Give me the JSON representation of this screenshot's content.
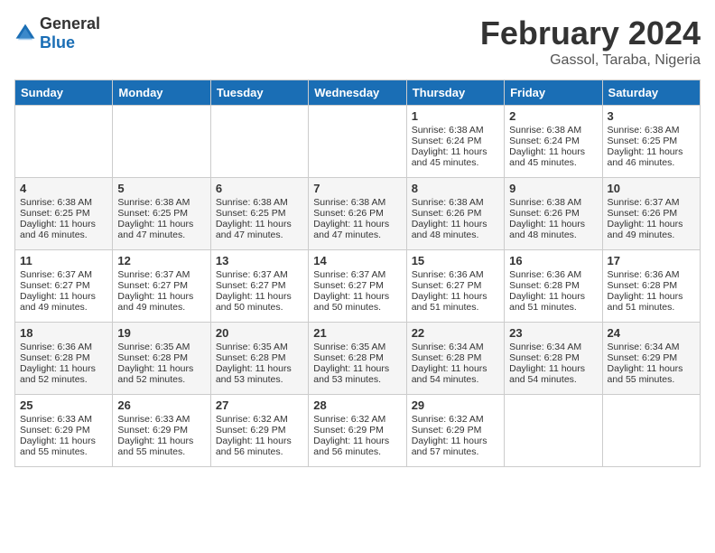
{
  "header": {
    "logo_general": "General",
    "logo_blue": "Blue",
    "month_year": "February 2024",
    "location": "Gassol, Taraba, Nigeria"
  },
  "days_of_week": [
    "Sunday",
    "Monday",
    "Tuesday",
    "Wednesday",
    "Thursday",
    "Friday",
    "Saturday"
  ],
  "weeks": [
    [
      {
        "day": "",
        "info": ""
      },
      {
        "day": "",
        "info": ""
      },
      {
        "day": "",
        "info": ""
      },
      {
        "day": "",
        "info": ""
      },
      {
        "day": "1",
        "sunrise": "6:38 AM",
        "sunset": "6:24 PM",
        "daylight": "11 hours and 45 minutes."
      },
      {
        "day": "2",
        "sunrise": "6:38 AM",
        "sunset": "6:24 PM",
        "daylight": "11 hours and 45 minutes."
      },
      {
        "day": "3",
        "sunrise": "6:38 AM",
        "sunset": "6:25 PM",
        "daylight": "11 hours and 46 minutes."
      }
    ],
    [
      {
        "day": "4",
        "sunrise": "6:38 AM",
        "sunset": "6:25 PM",
        "daylight": "11 hours and 46 minutes."
      },
      {
        "day": "5",
        "sunrise": "6:38 AM",
        "sunset": "6:25 PM",
        "daylight": "11 hours and 47 minutes."
      },
      {
        "day": "6",
        "sunrise": "6:38 AM",
        "sunset": "6:25 PM",
        "daylight": "11 hours and 47 minutes."
      },
      {
        "day": "7",
        "sunrise": "6:38 AM",
        "sunset": "6:26 PM",
        "daylight": "11 hours and 47 minutes."
      },
      {
        "day": "8",
        "sunrise": "6:38 AM",
        "sunset": "6:26 PM",
        "daylight": "11 hours and 48 minutes."
      },
      {
        "day": "9",
        "sunrise": "6:38 AM",
        "sunset": "6:26 PM",
        "daylight": "11 hours and 48 minutes."
      },
      {
        "day": "10",
        "sunrise": "6:37 AM",
        "sunset": "6:26 PM",
        "daylight": "11 hours and 49 minutes."
      }
    ],
    [
      {
        "day": "11",
        "sunrise": "6:37 AM",
        "sunset": "6:27 PM",
        "daylight": "11 hours and 49 minutes."
      },
      {
        "day": "12",
        "sunrise": "6:37 AM",
        "sunset": "6:27 PM",
        "daylight": "11 hours and 49 minutes."
      },
      {
        "day": "13",
        "sunrise": "6:37 AM",
        "sunset": "6:27 PM",
        "daylight": "11 hours and 50 minutes."
      },
      {
        "day": "14",
        "sunrise": "6:37 AM",
        "sunset": "6:27 PM",
        "daylight": "11 hours and 50 minutes."
      },
      {
        "day": "15",
        "sunrise": "6:36 AM",
        "sunset": "6:27 PM",
        "daylight": "11 hours and 51 minutes."
      },
      {
        "day": "16",
        "sunrise": "6:36 AM",
        "sunset": "6:28 PM",
        "daylight": "11 hours and 51 minutes."
      },
      {
        "day": "17",
        "sunrise": "6:36 AM",
        "sunset": "6:28 PM",
        "daylight": "11 hours and 51 minutes."
      }
    ],
    [
      {
        "day": "18",
        "sunrise": "6:36 AM",
        "sunset": "6:28 PM",
        "daylight": "11 hours and 52 minutes."
      },
      {
        "day": "19",
        "sunrise": "6:35 AM",
        "sunset": "6:28 PM",
        "daylight": "11 hours and 52 minutes."
      },
      {
        "day": "20",
        "sunrise": "6:35 AM",
        "sunset": "6:28 PM",
        "daylight": "11 hours and 53 minutes."
      },
      {
        "day": "21",
        "sunrise": "6:35 AM",
        "sunset": "6:28 PM",
        "daylight": "11 hours and 53 minutes."
      },
      {
        "day": "22",
        "sunrise": "6:34 AM",
        "sunset": "6:28 PM",
        "daylight": "11 hours and 54 minutes."
      },
      {
        "day": "23",
        "sunrise": "6:34 AM",
        "sunset": "6:28 PM",
        "daylight": "11 hours and 54 minutes."
      },
      {
        "day": "24",
        "sunrise": "6:34 AM",
        "sunset": "6:29 PM",
        "daylight": "11 hours and 55 minutes."
      }
    ],
    [
      {
        "day": "25",
        "sunrise": "6:33 AM",
        "sunset": "6:29 PM",
        "daylight": "11 hours and 55 minutes."
      },
      {
        "day": "26",
        "sunrise": "6:33 AM",
        "sunset": "6:29 PM",
        "daylight": "11 hours and 55 minutes."
      },
      {
        "day": "27",
        "sunrise": "6:32 AM",
        "sunset": "6:29 PM",
        "daylight": "11 hours and 56 minutes."
      },
      {
        "day": "28",
        "sunrise": "6:32 AM",
        "sunset": "6:29 PM",
        "daylight": "11 hours and 56 minutes."
      },
      {
        "day": "29",
        "sunrise": "6:32 AM",
        "sunset": "6:29 PM",
        "daylight": "11 hours and 57 minutes."
      },
      {
        "day": "",
        "info": ""
      },
      {
        "day": "",
        "info": ""
      }
    ]
  ],
  "labels": {
    "sunrise": "Sunrise:",
    "sunset": "Sunset:",
    "daylight": "Daylight:"
  }
}
